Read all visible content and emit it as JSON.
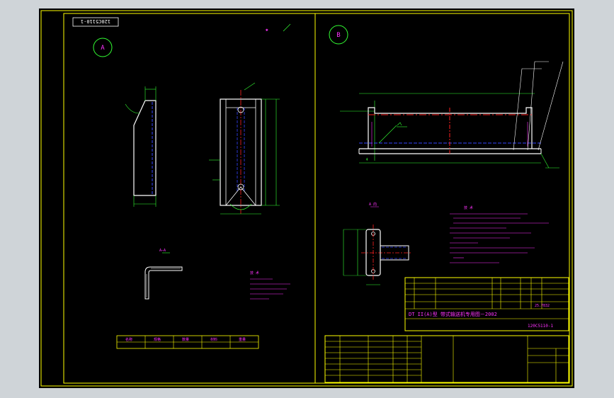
{
  "drawing": {
    "drawing_number_rotated": "120C5110-1",
    "view_a_label": "A",
    "view_b_label": "B",
    "section_a_label": "A 向",
    "detail_label": "A—A",
    "title_line": "DT II(A)型  带式输送机专用图－2002",
    "drawing_no": "120C5110-1",
    "title_block_right_value": "25.7832",
    "notes_heading": "技 术",
    "small_table_header": [
      "名称",
      "规格",
      "数量",
      "材料",
      "重量"
    ],
    "colors": {
      "sheet": "#000000",
      "frame": "#ffff00",
      "geometry": "#ffffff",
      "dimensions": "#33ff33",
      "centerline": "#ff2020",
      "hidden": "#3344ff",
      "text": "#ff33ff"
    }
  }
}
